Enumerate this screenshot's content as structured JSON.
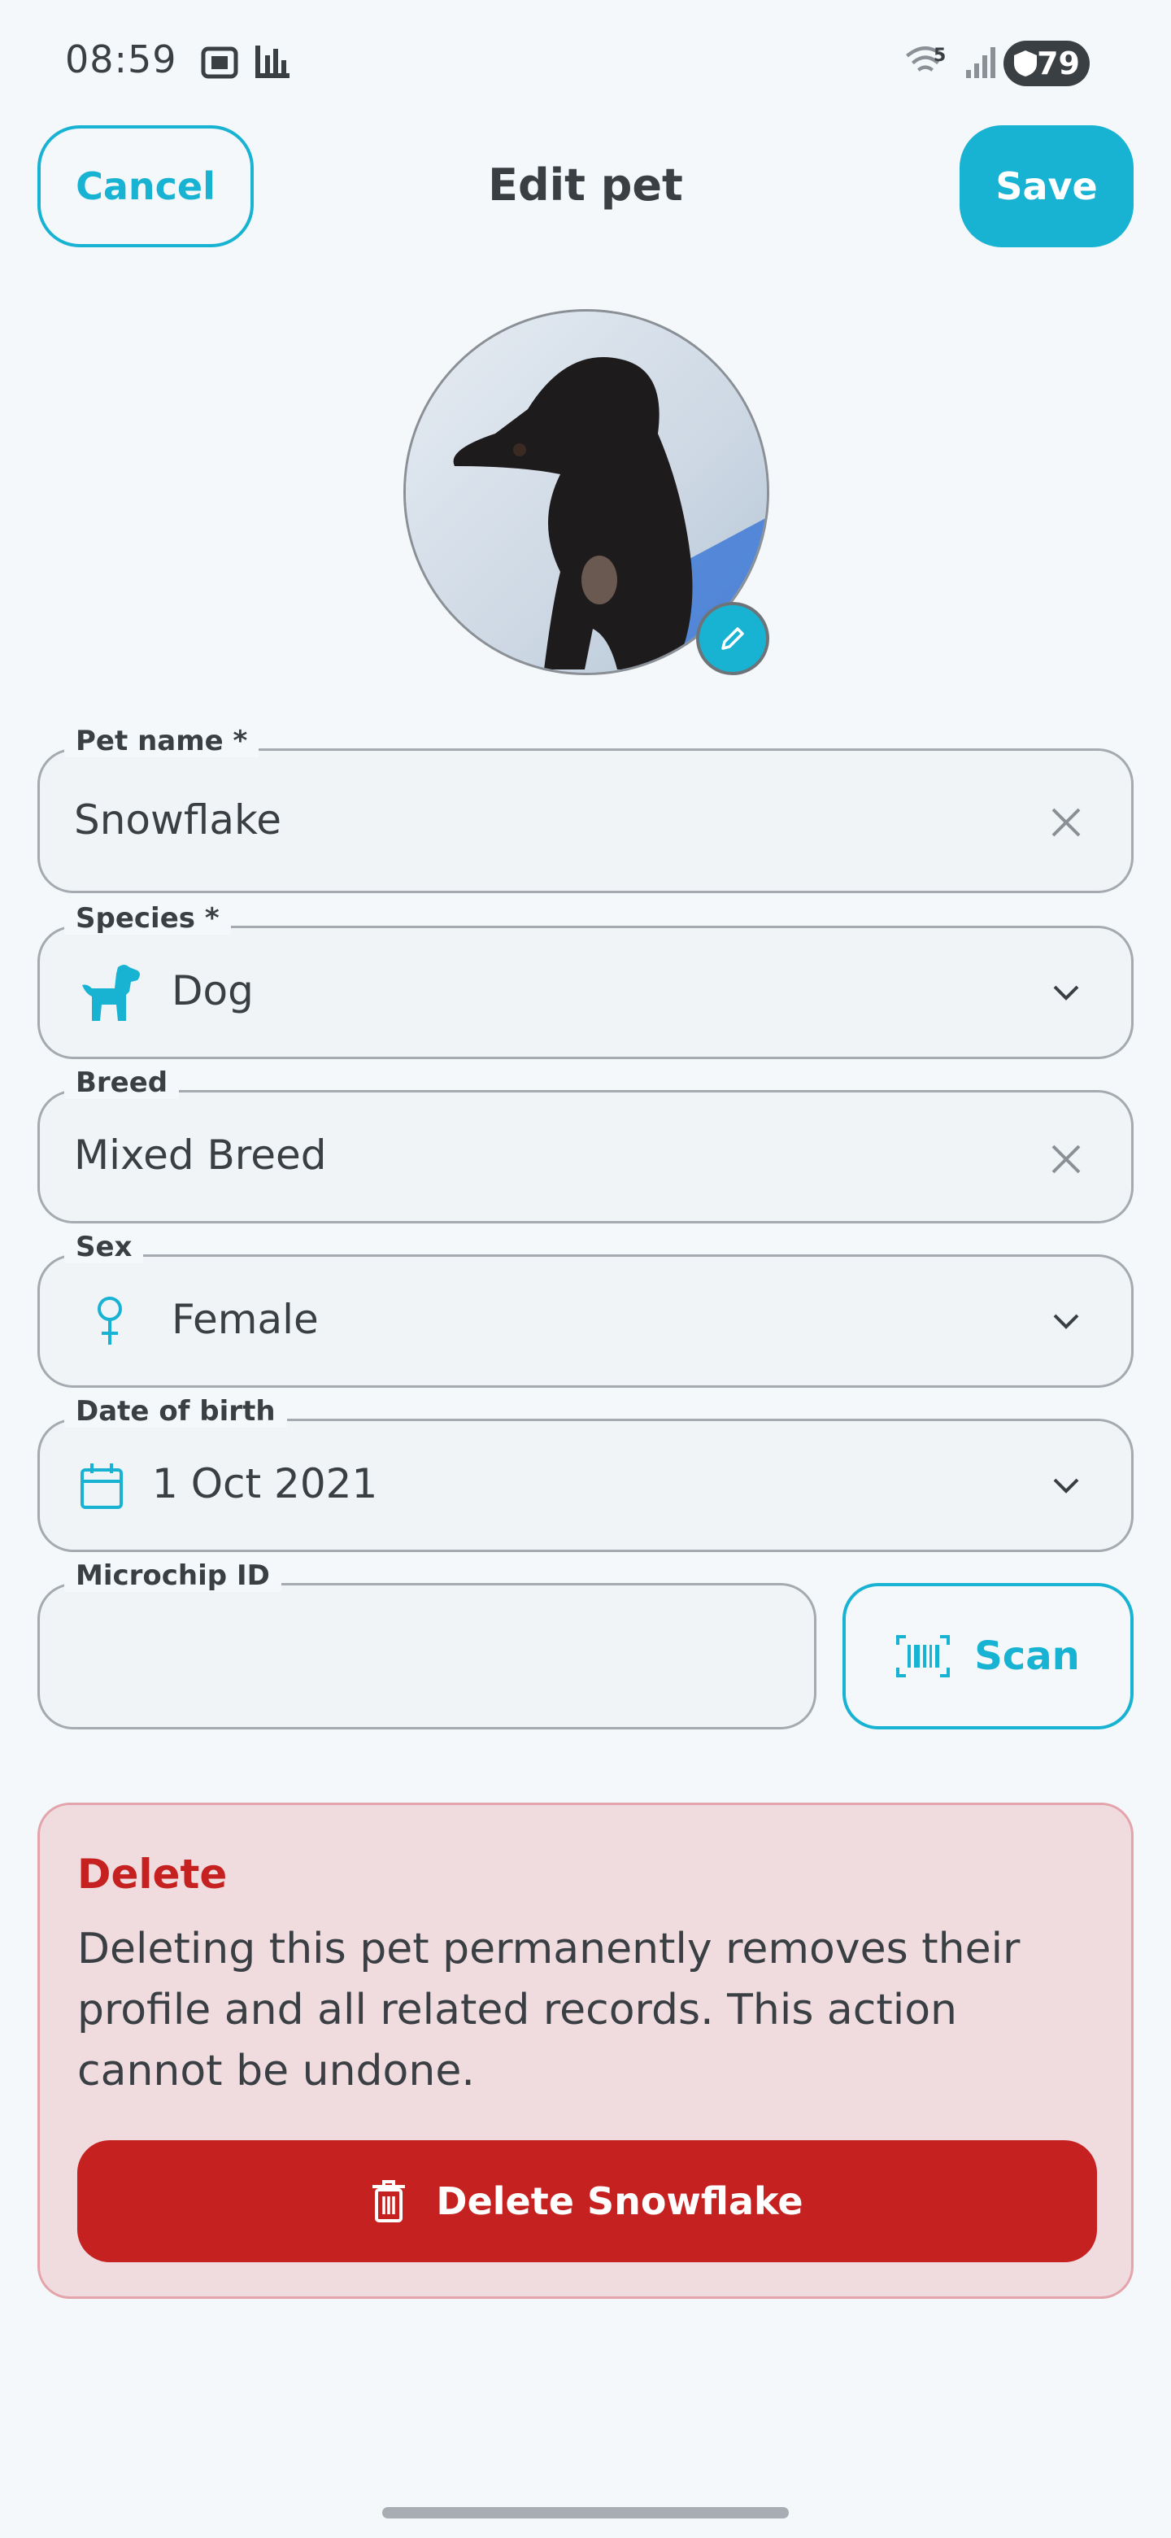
{
  "status_bar": {
    "time": "08:59",
    "wifi_badge": "5",
    "battery": "79",
    "icons": [
      "screenshot-icon",
      "chart-icon",
      "wifi-icon",
      "signal-icon",
      "shield-icon"
    ]
  },
  "header": {
    "cancel_label": "Cancel",
    "title": "Edit pet",
    "save_label": "Save"
  },
  "avatar": {
    "alt": "Photo of a black dog sitting in snow",
    "edit_icon": "pencil-icon"
  },
  "fields": {
    "pet_name": {
      "label": "Pet name *",
      "value": "Snowflake",
      "icon": "clear-icon"
    },
    "species": {
      "label": "Species *",
      "value": "Dog",
      "icon": "dog-icon"
    },
    "breed": {
      "label": "Breed",
      "value": "Mixed Breed",
      "icon": "clear-icon"
    },
    "sex": {
      "label": "Sex",
      "value": "Female",
      "icon": "female-icon"
    },
    "date_of_birth": {
      "label": "Date of birth",
      "value": "1 Oct 2021",
      "icon": "calendar-icon"
    },
    "microchip": {
      "label": "Microchip ID",
      "value": ""
    }
  },
  "scan_button": {
    "label": "Scan",
    "icon": "barcode-icon"
  },
  "danger": {
    "title": "Delete",
    "description": "Deleting this pet permanently removes their profile and all related records. This action cannot be undone.",
    "button_label": "Delete Snowflake",
    "button_icon": "trash-icon"
  },
  "colors": {
    "accent": "#18b3d3",
    "danger": "#c62121",
    "danger_bg": "#f0dcdf",
    "background": "#f4f8fa",
    "text": "#3a3f44"
  }
}
